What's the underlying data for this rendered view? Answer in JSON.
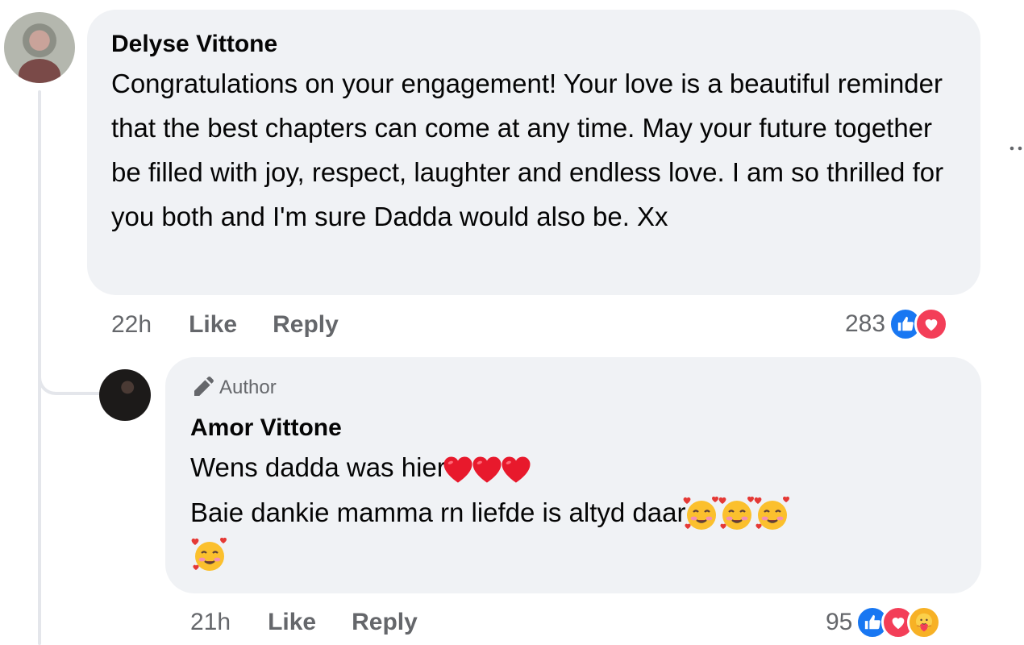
{
  "comments": [
    {
      "author": "Delyse Vittone",
      "text": "Congratulations on your engagement! Your love is a beautiful reminder that the best chapters can come at any time. May your future together be filled with joy, respect, laughter and endless love. I am so thrilled for you both and I'm sure Dadda would also be. Xx",
      "time": "22h",
      "like_label": "Like",
      "reply_label": "Reply",
      "reaction_count": "283",
      "reactions": [
        "like-icon",
        "love-icon"
      ]
    }
  ],
  "replies": [
    {
      "badge": "Author",
      "author": "Amor Vittone",
      "line1": "Wens dadda was hier",
      "line1_emoji": [
        "red-heart",
        "red-heart",
        "red-heart"
      ],
      "line2": "Baie dankie mamma rn liefde is altyd daar",
      "line2_emoji": [
        "smiling-face-with-hearts",
        "smiling-face-with-hearts",
        "smiling-face-with-hearts",
        "smiling-face-with-hearts"
      ],
      "time": "21h",
      "like_label": "Like",
      "reply_label": "Reply",
      "reaction_count": "95",
      "reactions": [
        "like-icon",
        "love-icon",
        "care-icon"
      ]
    }
  ],
  "colors": {
    "bubble": "#f0f2f5",
    "secondary_text": "#65676b",
    "like_blue": "#1877f2",
    "love_red": "#f33e58",
    "care_yellow": "#f7b125"
  }
}
